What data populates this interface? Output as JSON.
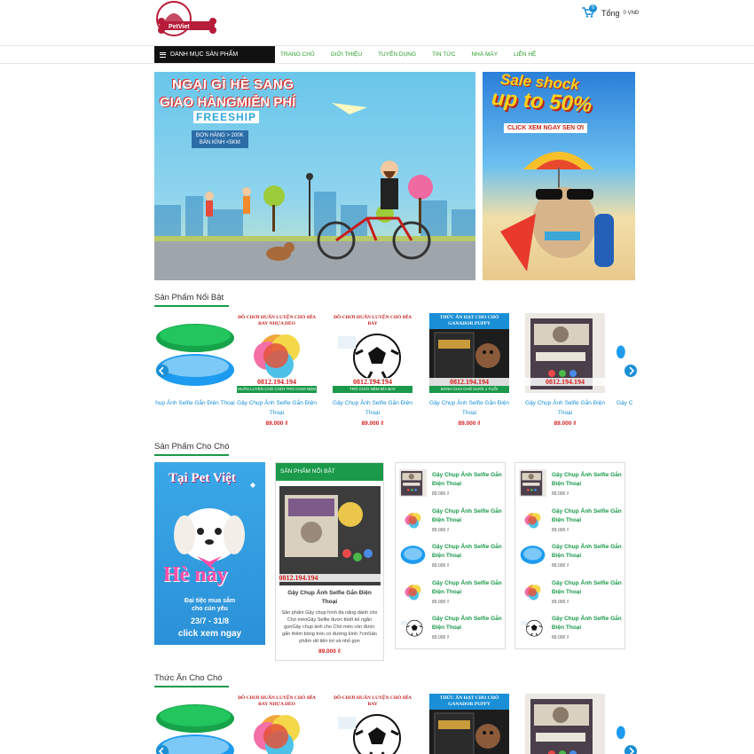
{
  "header": {
    "logo_text": "PetViet",
    "cart_count": "0",
    "cart_total_label": "Tổng",
    "cart_total_value": "0 VNĐ"
  },
  "nav": {
    "category_menu": "DANH MỤC SẢN PHẨM",
    "items": [
      "TRANG CHỦ",
      "GIỚI THIỆU",
      "TUYỂN DỤNG",
      "TIN TỨC",
      "NHÀ MÁY",
      "LIÊN HỆ"
    ]
  },
  "banner_main": {
    "line1": "NGẠI GÌ HÈ SANG",
    "line2": "GIAO HÀNGMIỄN PHÍ",
    "freeship": "FREESHIP",
    "cond1": "ĐƠN HÀNG > 200K",
    "cond2": "BÁN KÍNH <5KM"
  },
  "banner_side": {
    "sale": "Sale shock",
    "upto": "up to 50%",
    "click": "CLICK XEM NGAY SEN ƠI"
  },
  "sections": {
    "featured_title": "Sản Phẩm Nổi Bật",
    "dog_title": "Sản Phẩm Cho Chó",
    "food_title": "Thức Ăn Cho Chó"
  },
  "featured_products": [
    {
      "name": "hụp Ảnh Selfie Gắn Điện Thoại",
      "price": "",
      "kind": "frisbee"
    },
    {
      "name": "Gậy Chụp Ảnh Selfie Gắn Điện Thoại",
      "price": "89.000 ₫",
      "kind": "poster",
      "head": "ĐỒ CHƠI HUẤN LUYỆN CHÓ ĐĨA BAY NHỰA DẺO",
      "phone": "0812.194.194",
      "foot": "HUẤN LUYỆN CHÓ CHƠI TRÒ CHƠI NÉM ĐĨA"
    },
    {
      "name": "Gậy Chụp Ảnh Selfie Gắn Điện Thoại",
      "price": "89.000 ₫",
      "kind": "ball",
      "head": "ĐỒ CHƠI HUẤN LUYỆN CHÓ ĐĨA BAY",
      "phone": "0812.194.194",
      "foot": "TRÒ CHƠI NÉM ĐĨA BAY"
    },
    {
      "name": "Gậy Chụp Ảnh Selfie Gắn Điện Thoại",
      "price": "89.000 ₫",
      "kind": "food",
      "head": "THỨC ĂN HẠT CHO CHÓ GANADOR PUPPY",
      "phone": "0812.194.194",
      "foot": "DÀNH CHO CHÓ DƯỚI 1 TUỔI"
    },
    {
      "name": "Gậy Chụp Ảnh Selfie Gắn Điện Thoại",
      "price": "89.000 ₫",
      "kind": "litter",
      "head": "",
      "phone": "0812.194.194",
      "foot": ""
    },
    {
      "name": "Gậy C",
      "price": "",
      "kind": "partial"
    }
  ],
  "promo_dog": {
    "title": "Tại Pet Việt",
    "he": "Hè này",
    "sub1": "Đại tiệc mua sắm",
    "sub2": "cho cún yêu",
    "date": "23/7 - 31/8",
    "click": "click xem ngay"
  },
  "featured_box": {
    "header": "SẢN PHẨM NỔI BẬT",
    "phone": "0812.194.194",
    "name": "Gậy Chụp Ảnh Selfie Gắn Điện Thoại",
    "desc": "Sản phẩm Gậy chụp hình đa năng dành cho Chó mèoGậy Selfie được thiết kế ngắn gọnGậy chụp ảnh cho Chó mèo còn được gắn thêm bông tròn có đường kính 7cmSản phẩm rất tiện lợi và nhỏ gọn",
    "price": "89.000 ₫"
  },
  "list_a": [
    {
      "name": "Gậy Chụp Ảnh Selfie Gắn Điện Thoại",
      "price": "89.000 ₫",
      "kind": "litter"
    },
    {
      "name": "Gậy Chụp Ảnh Selfie Gắn Điện Thoại",
      "price": "89.000 ₫",
      "kind": "multi"
    },
    {
      "name": "Gậy Chụp Ảnh Selfie Gắn Điện Thoại",
      "price": "89.000 ₫",
      "kind": "blue"
    },
    {
      "name": "Gậy Chụp Ảnh Selfie Gắn Điện Thoại",
      "price": "89.000 ₫",
      "kind": "poster"
    },
    {
      "name": "Gậy Chụp Ảnh Selfie Gắn Điện Thoại",
      "price": "89.000 ₫",
      "kind": "ball"
    }
  ],
  "list_b": [
    {
      "name": "Gậy Chụp Ảnh Selfie Gắn Điện Thoại",
      "price": "89.000 ₫",
      "kind": "litter"
    },
    {
      "name": "Gậy Chụp Ảnh Selfie Gắn Điện Thoại",
      "price": "89.000 ₫",
      "kind": "multi"
    },
    {
      "name": "Gậy Chụp Ảnh Selfie Gắn Điện Thoại",
      "price": "89.000 ₫",
      "kind": "blue"
    },
    {
      "name": "Gậy Chụp Ảnh Selfie Gắn Điện Thoại",
      "price": "89.000 ₫",
      "kind": "poster"
    },
    {
      "name": "Gậy Chụp Ảnh Selfie Gắn Điện Thoại",
      "price": "89.000 ₫",
      "kind": "ball"
    }
  ],
  "food_products": [
    {
      "kind": "frisbee"
    },
    {
      "kind": "poster",
      "head": "ĐỒ CHƠI HUẤN LUYỆN CHÓ ĐĨA BAY NHỰA DẺO"
    },
    {
      "kind": "ball",
      "head": "ĐỒ CHƠI HUẤN LUYỆN CHÓ ĐĨA BAY"
    },
    {
      "kind": "food",
      "head": "THỨC ĂN HẠT CHO CHÓ GANADOR PUPPY"
    },
    {
      "kind": "litter"
    },
    {
      "kind": "partial"
    }
  ],
  "colors": {
    "green": "#1a9a4a",
    "blue": "#1a8fd6",
    "red": "#d61e1e"
  }
}
